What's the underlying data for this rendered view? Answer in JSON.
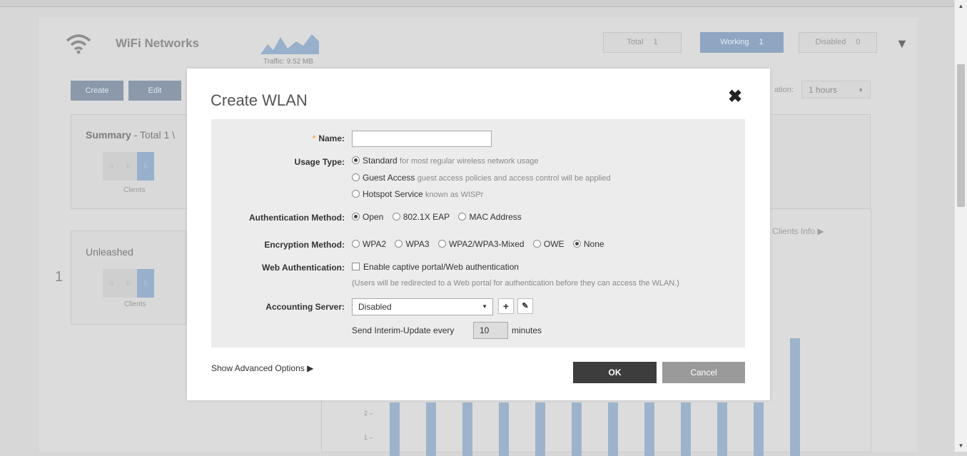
{
  "background": {
    "title": "WiFi Networks",
    "traffic_label": "Traffic: 9.52 MB",
    "stats": [
      {
        "label": "Total",
        "value": "1"
      },
      {
        "label": "Working",
        "value": "1"
      },
      {
        "label": "Disabled",
        "value": "0"
      }
    ],
    "buttons": {
      "create": "Create",
      "edit": "Edit"
    },
    "duration_label": "ation:",
    "duration_value": "1 hours",
    "summary_title": "Summary",
    "summary_subtitle": "- Total 1 \\",
    "summary_counts": [
      "0",
      "0",
      "5"
    ],
    "clients_label": "Clients",
    "network_name": "Unleashed",
    "network_index": "1",
    "network_counts": [
      "0",
      "0",
      "5"
    ],
    "network_clients_label": "Clients",
    "clients_info": "Clients Info",
    "axis_ticks": [
      "2 –",
      "1 –"
    ]
  },
  "modal": {
    "title": "Create WLAN",
    "close": "✖",
    "fields": {
      "name_label": "Name:",
      "name_value": "",
      "usage_label": "Usage Type:",
      "usage_options": [
        {
          "label": "Standard",
          "hint": "for most regular wireless network usage",
          "selected": true
        },
        {
          "label": "Guest Access",
          "hint": "guest access policies and access control will be applied",
          "selected": false
        },
        {
          "label": "Hotspot Service",
          "hint": "known as WISPr",
          "selected": false
        }
      ],
      "auth_label": "Authentication Method:",
      "auth_options": [
        "Open",
        "802.1X EAP",
        "MAC Address"
      ],
      "auth_selected": "Open",
      "enc_label": "Encryption Method:",
      "enc_options": [
        "WPA2",
        "WPA3",
        "WPA2/WPA3-Mixed",
        "OWE",
        "None"
      ],
      "enc_selected": "None",
      "webauth_label": "Web Authentication:",
      "webauth_text": "Enable captive portal/Web authentication",
      "webauth_note": "(Users will be redirected to a Web portal for authentication before they can access the WLAN.)",
      "acct_label": "Accounting Server:",
      "acct_value": "Disabled",
      "interim_prefix": "Send Interim-Update every",
      "interim_value": "10",
      "interim_suffix": "minutes"
    },
    "advanced": "Show Advanced Options ▶",
    "ok": "OK",
    "cancel": "Cancel"
  }
}
